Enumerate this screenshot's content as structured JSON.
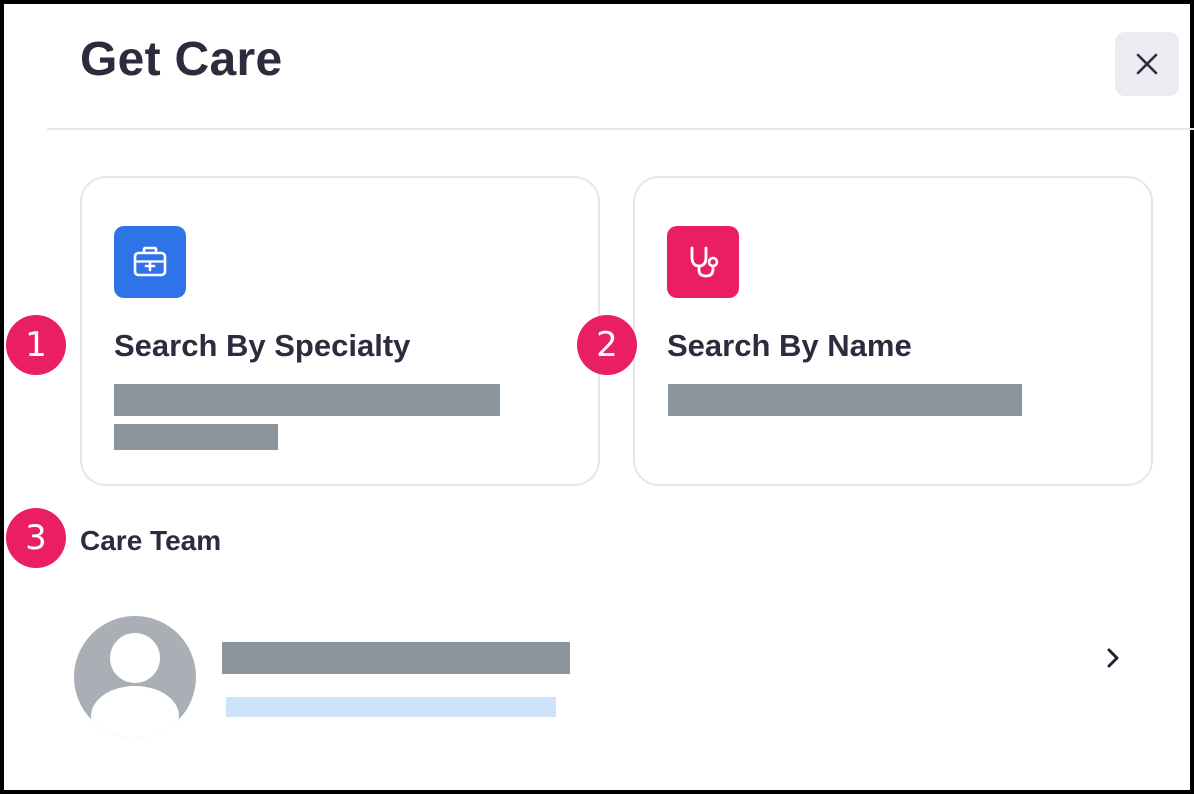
{
  "header": {
    "title": "Get Care",
    "close_icon": "close-icon"
  },
  "cards": [
    {
      "title": "Search By Specialty",
      "icon": "medical-kit-icon",
      "icon_color": "#2f73e8",
      "annotation": "1"
    },
    {
      "title": "Search By Name",
      "icon": "stethoscope-icon",
      "icon_color": "#e91e63",
      "annotation": "2"
    }
  ],
  "care_team": {
    "title": "Care Team",
    "annotation": "3",
    "member": {
      "avatar_icon": "user-avatar-icon",
      "chevron_icon": "chevron-right-icon"
    }
  },
  "colors": {
    "accent_pink": "#e91e63",
    "accent_blue": "#2f73e8",
    "redacted_gray": "#8a959e",
    "redacted_light_blue": "#cfe3f8",
    "text_dark": "#2b2d3f"
  }
}
